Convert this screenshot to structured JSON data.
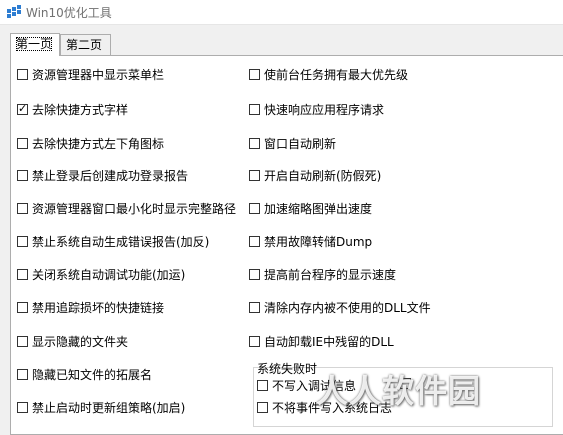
{
  "window": {
    "title": "Win10优化工具"
  },
  "tabs": [
    {
      "label": "第一页",
      "active": true
    },
    {
      "label": "第二页",
      "active": false
    }
  ],
  "left_options": [
    {
      "label": "资源管理器中显示菜单栏",
      "checked": false
    },
    {
      "label": "去除快捷方式字样",
      "checked": true
    },
    {
      "label": "去除快捷方式左下角图标",
      "checked": false
    },
    {
      "label": "禁止登录后创建成功登录报告",
      "checked": false
    },
    {
      "label": "资源管理器窗口最小化时显示完整路径",
      "checked": false
    },
    {
      "label": "禁止系统自动生成错误报告(加反)",
      "checked": false
    },
    {
      "label": "关闭系统自动调试功能(加运)",
      "checked": false
    },
    {
      "label": "禁用追踪损坏的快捷链接",
      "checked": false
    },
    {
      "label": "显示隐藏的文件夹",
      "checked": false
    },
    {
      "label": "隐藏已知文件的拓展名",
      "checked": false
    },
    {
      "label": "禁止启动时更新组策略(加启)",
      "checked": false
    }
  ],
  "right_options": [
    {
      "label": "使前台任务拥有最大优先级",
      "checked": false
    },
    {
      "label": "快速响应应用程序请求",
      "checked": false
    },
    {
      "label": "窗口自动刷新",
      "checked": false
    },
    {
      "label": "开启自动刷新(防假死)",
      "checked": false
    },
    {
      "label": "加速缩略图弹出速度",
      "checked": false
    },
    {
      "label": "禁用故障转储Dump",
      "checked": false
    },
    {
      "label": "提高前台程序的显示速度",
      "checked": false
    },
    {
      "label": "清除内存内被不使用的DLL文件",
      "checked": false
    },
    {
      "label": "自动卸载IE中残留的DLL",
      "checked": false
    }
  ],
  "system_failure": {
    "title": "系统失败时",
    "options": [
      {
        "label": "不写入调试信息",
        "checked": false
      },
      {
        "label": "不将事件写入系统日志",
        "checked": false
      }
    ]
  },
  "watermark": "人人软件园",
  "check_glyph": "✓"
}
